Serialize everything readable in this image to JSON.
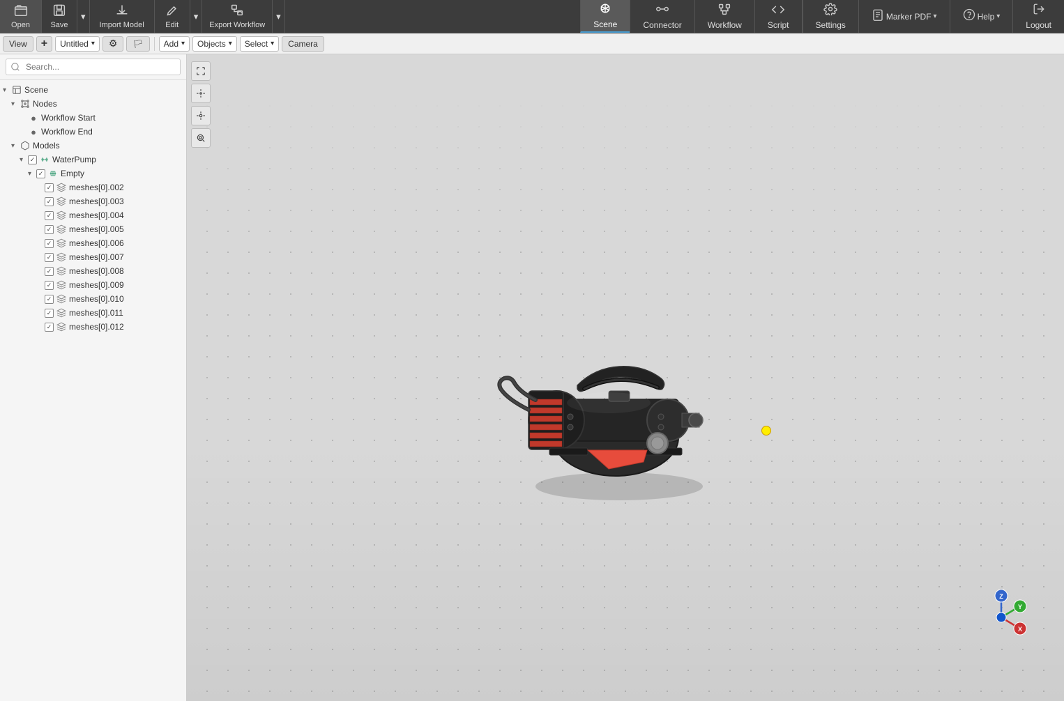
{
  "toolbar": {
    "open_label": "Open",
    "save_label": "Save",
    "import_model_label": "Import Model",
    "edit_label": "Edit",
    "export_workflow_label": "Export Workflow",
    "scene_label": "Scene",
    "connector_label": "Connector",
    "workflow_label": "Workflow",
    "script_label": "Script",
    "settings_label": "Settings",
    "marker_pdf_label": "Marker PDF",
    "help_label": "Help",
    "logout_label": "Logout"
  },
  "second_toolbar": {
    "view_label": "View",
    "add_label": "Add",
    "objects_label": "Objects",
    "select_label": "Select",
    "camera_label": "Camera",
    "scene_name": "Untitled"
  },
  "search": {
    "placeholder": "Search..."
  },
  "tree": {
    "scene_label": "Scene",
    "nodes_label": "Nodes",
    "workflow_start_label": "Workflow Start",
    "workflow_end_label": "Workflow End",
    "models_label": "Models",
    "water_pump_label": "WaterPump",
    "empty_label": "Empty",
    "meshes": [
      "meshes[0].002",
      "meshes[0].003",
      "meshes[0].004",
      "meshes[0].005",
      "meshes[0].006",
      "meshes[0].007",
      "meshes[0].008",
      "meshes[0].009",
      "meshes[0].010",
      "meshes[0].011",
      "meshes[0].012"
    ]
  },
  "viewport_tools": {
    "maximize_icon": "⤢",
    "eye_icon": "👁",
    "move_icon": "⊕",
    "zoom_icon": "⊕"
  },
  "axis": {
    "x_label": "X",
    "y_label": "Y",
    "z_label": "Z"
  }
}
